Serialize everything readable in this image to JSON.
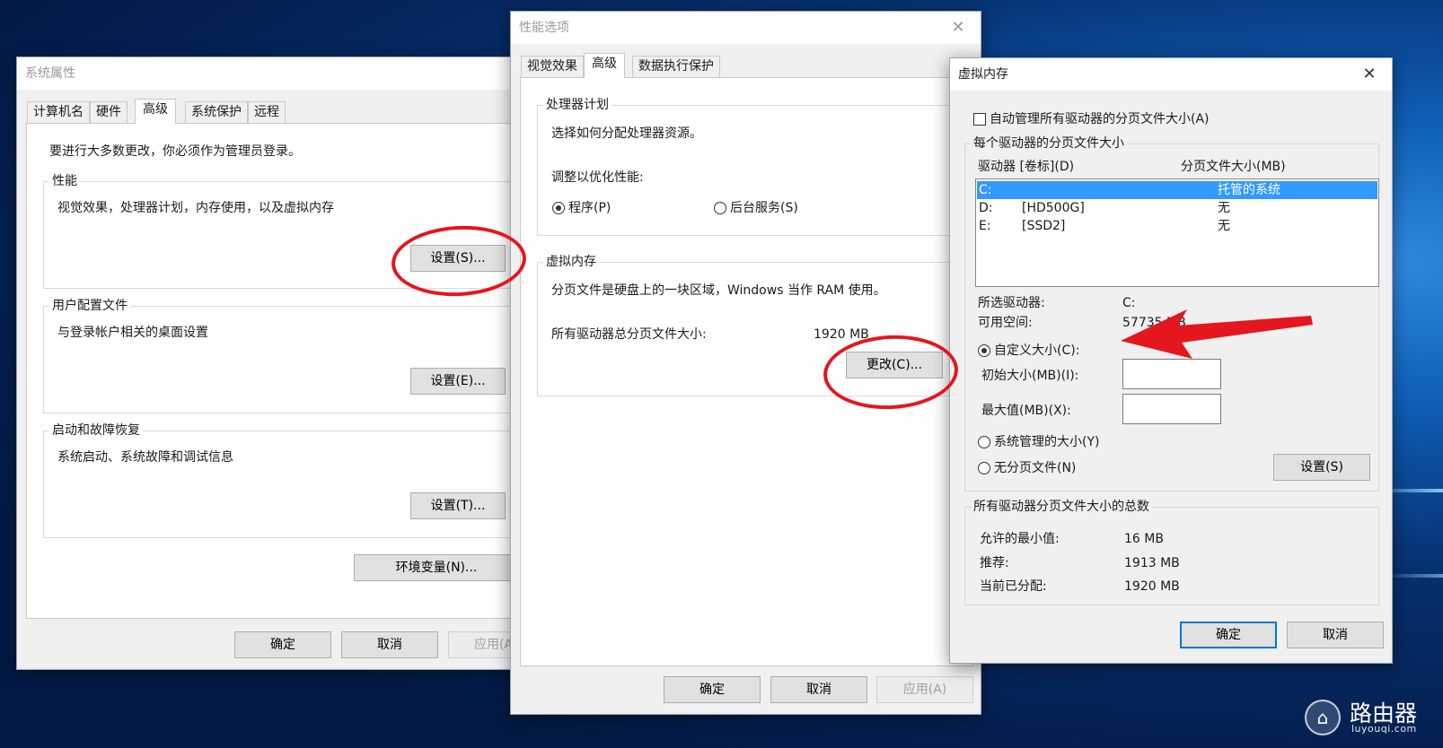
{
  "system_properties": {
    "title": "系统属性",
    "tabs": [
      "计算机名",
      "硬件",
      "高级",
      "系统保护",
      "远程"
    ],
    "admin_notice": "要进行大多数更改，你必须作为管理员登录。",
    "performance": {
      "title": "性能",
      "desc": "视觉效果，处理器计划，内存使用，以及虚拟内存",
      "button": "设置(S)..."
    },
    "user_profiles": {
      "title": "用户配置文件",
      "desc": "与登录帐户相关的桌面设置",
      "button": "设置(E)..."
    },
    "startup_recovery": {
      "title": "启动和故障恢复",
      "desc": "系统启动、系统故障和调试信息",
      "button": "设置(T)..."
    },
    "env_button": "环境变量(N)...",
    "footer": {
      "ok": "确定",
      "cancel": "取消",
      "apply": "应用(A)"
    }
  },
  "performance_options": {
    "title": "性能选项",
    "tabs": [
      "视觉效果",
      "高级",
      "数据执行保护"
    ],
    "processor": {
      "title": "处理器计划",
      "desc": "选择如何分配处理器资源。",
      "adjust_label": "调整以优化性能:",
      "programs": "程序(P)",
      "background": "后台服务(S)"
    },
    "virtual_memory": {
      "title": "虚拟内存",
      "desc": "分页文件是硬盘上的一块区域，Windows 当作 RAM 使用。",
      "total_label": "所有驱动器总分页文件大小:",
      "total_value": "1920 MB",
      "change_button": "更改(C)..."
    },
    "footer": {
      "ok": "确定",
      "cancel": "取消",
      "apply": "应用(A)"
    }
  },
  "virtual_memory": {
    "title": "虚拟内存",
    "auto_manage": "自动管理所有驱动器的分页文件大小(A)",
    "per_drive_title": "每个驱动器的分页文件大小",
    "col_drive": "驱动器 [卷标](D)",
    "col_size": "分页文件大小(MB)",
    "drives": [
      {
        "letter": "C:",
        "label": "",
        "size": "托管的系统"
      },
      {
        "letter": "D:",
        "label": "[HD500G]",
        "size": "无"
      },
      {
        "letter": "E:",
        "label": "[SSD2]",
        "size": "无"
      }
    ],
    "selected_drive_label": "所选驱动器:",
    "selected_drive_value": "C:",
    "free_space_label": "可用空间:",
    "free_space_value": "57735 MB",
    "custom_size": "自定义大小(C):",
    "initial_size_label": "初始大小(MB)(I):",
    "initial_size_value": "",
    "max_size_label": "最大值(MB)(X):",
    "max_size_value": "",
    "system_managed": "系统管理的大小(Y)",
    "no_paging": "无分页文件(N)",
    "set_button": "设置(S)",
    "totals_title": "所有驱动器分页文件大小的总数",
    "min_allowed_label": "允许的最小值:",
    "min_allowed_value": "16 MB",
    "recommended_label": "推荐:",
    "recommended_value": "1913 MB",
    "current_label": "当前已分配:",
    "current_value": "1920 MB",
    "ok": "确定",
    "cancel": "取消"
  },
  "watermark": {
    "title": "路由器",
    "url": "luyouqi.com",
    "icon": "router-icon"
  },
  "colors": {
    "annotation_red": "#e4161e",
    "selection_blue": "#3399ff",
    "default_button_border": "#0078d7"
  }
}
